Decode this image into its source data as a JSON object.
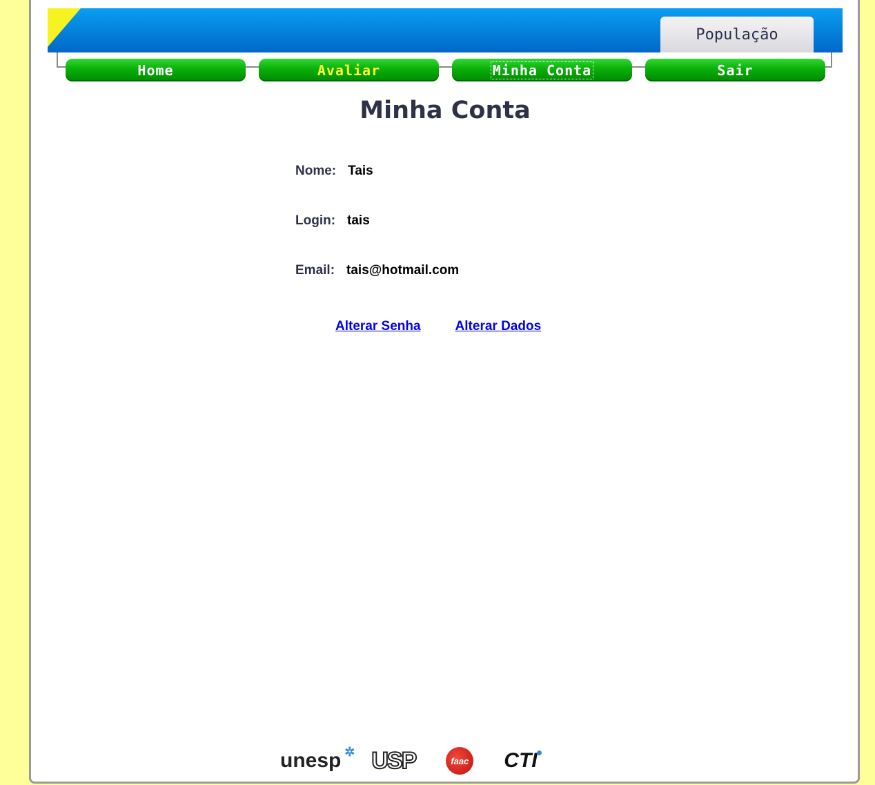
{
  "header": {
    "section_tab": "População"
  },
  "nav": [
    {
      "label": "Home",
      "highlight": false
    },
    {
      "label": "Avaliar",
      "highlight": true
    },
    {
      "label": "Minha Conta",
      "highlight": false,
      "focused": true
    },
    {
      "label": "Sair",
      "highlight": false
    }
  ],
  "page": {
    "title": "Minha Conta"
  },
  "account": {
    "name_label": "Nome:",
    "name_value": "Tais",
    "login_label": "Login:",
    "login_value": "tais",
    "email_label": "Email:",
    "email_value": "tais@hotmail.com"
  },
  "links": {
    "change_password": "Alterar Senha",
    "change_data": "Alterar Dados"
  },
  "footer": {
    "logos": [
      "unesp",
      "USP",
      "faac",
      "CTI"
    ]
  },
  "colors": {
    "page_bg": "#ffff99",
    "nav_green": "#09b009",
    "header_blue": "#0a9ef0",
    "link": "#0000ee",
    "title": "#2f3148"
  }
}
